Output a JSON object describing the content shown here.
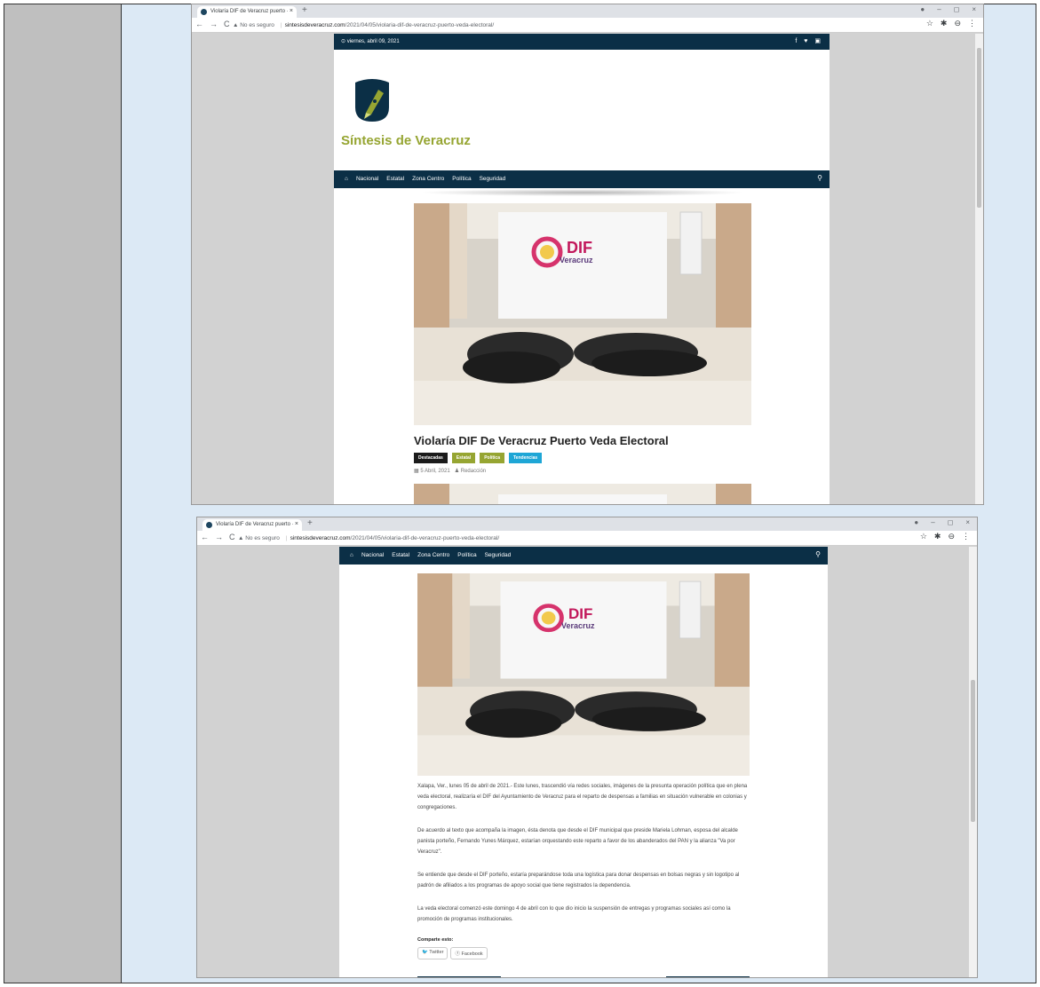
{
  "browser": {
    "tab_title": "Violaría DIF de Veracruz puerto ·",
    "tab_close": "×",
    "new_tab": "+",
    "window_controls": [
      "●",
      "–",
      "◻",
      "×"
    ],
    "back": "←",
    "forward": "→",
    "reload": "C",
    "security_warning": "▲ No es seguro",
    "url_domain": "sintesisdeveracruz.com",
    "url_path": "/2021/04/05/violaria-dif-de-veracruz-puerto-veda-electoral/",
    "toolbar_icons": [
      "☆",
      "✱",
      "⊖",
      "⋮"
    ]
  },
  "site": {
    "date": "⊙ viernes, abril 09, 2021",
    "social_icons": "f ♥ ▣",
    "title": "Síntesis de Veracruz",
    "home_icon": "⌂",
    "nav_items": [
      "Nacional",
      "Estatal",
      "Zona Centro",
      "Política",
      "Seguridad"
    ],
    "search_icon": "⚲"
  },
  "photo": {
    "logo_text": "DIF",
    "logo_sub": "Veracruz"
  },
  "article": {
    "title": "Violaría DIF De Veracruz Puerto Veda Electoral",
    "categories": [
      "Destacadas",
      "Estatal",
      "Política",
      "Tendencias"
    ],
    "date": "▦ 5 Abril, 2021",
    "author": "♟ Redacción",
    "paragraphs": [
      "Xalapa, Ver., lunes 05 de abril de 2021.- Este lunes, trascendió vía redes sociales, imágenes de la presunta operación política que en plena veda electoral, realizaría el DIF del Ayuntamiento de Veracruz para el reparto de despensas a familias en situación vulnerable en colonias y congregaciones.",
      "De acuerdo al texto que acompaña la imagen, ésta denota que desde el DIF municipal que preside Mariela Lohman, esposa del alcalde panista porteño, Fernando Yunes Márquez, estarían orquestando este reparto a favor de los abanderados del PAN y la alianza \"Va por Veracruz\".",
      "Se entiende que desde el DIF porteño, estaría preparándose toda una logística para donar despensas en bolsas negras y sin logotipo al padrón de afiliados a los programas de apoyo social que tiene registrados la dependencia.",
      "La veda electoral comenzó este domingo 4 de abril con lo que dio inicio la suspensión de entregas y programas sociales así como la promoción de programas institucionales."
    ],
    "share_label": "Comparte esto:",
    "share_twitter": "🐦 Twitter",
    "share_facebook": "ⓕ Facebook"
  },
  "colors": {
    "brand_navy": "#0b2f46",
    "brand_olive": "#96a532",
    "tag_blue": "#1ea6d6"
  }
}
